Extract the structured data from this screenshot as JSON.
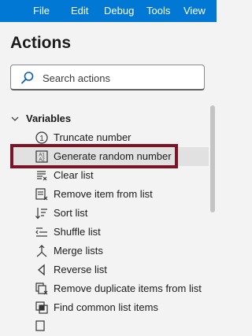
{
  "menubar": {
    "items": [
      {
        "label": "File"
      },
      {
        "label": "Edit"
      },
      {
        "label": "Debug"
      },
      {
        "label": "Tools"
      },
      {
        "label": "View"
      }
    ]
  },
  "panel": {
    "title": "Actions",
    "search": {
      "placeholder": "Search actions",
      "value": "",
      "icon": "search-icon"
    }
  },
  "group": {
    "label": "Variables",
    "expanded": true,
    "actions": [
      {
        "label": "Truncate number",
        "icon": "truncate-number-icon"
      },
      {
        "label": "Generate random number",
        "icon": "random-number-icon",
        "selected": true
      },
      {
        "label": "Clear list",
        "icon": "clear-list-icon"
      },
      {
        "label": "Remove item from list",
        "icon": "remove-item-icon"
      },
      {
        "label": "Sort list",
        "icon": "sort-list-icon"
      },
      {
        "label": "Shuffle list",
        "icon": "shuffle-list-icon"
      },
      {
        "label": "Merge lists",
        "icon": "merge-lists-icon"
      },
      {
        "label": "Reverse list",
        "icon": "reverse-list-icon"
      },
      {
        "label": "Remove duplicate items from list",
        "icon": "remove-duplicates-icon"
      },
      {
        "label": "Find common list items",
        "icon": "common-items-icon"
      }
    ]
  },
  "colors": {
    "menubar_bg": "#0078d4",
    "highlight_border": "#7a1426",
    "selected_row_bg": "#e1e1e1",
    "panel_bg": "#f3f3f3"
  }
}
